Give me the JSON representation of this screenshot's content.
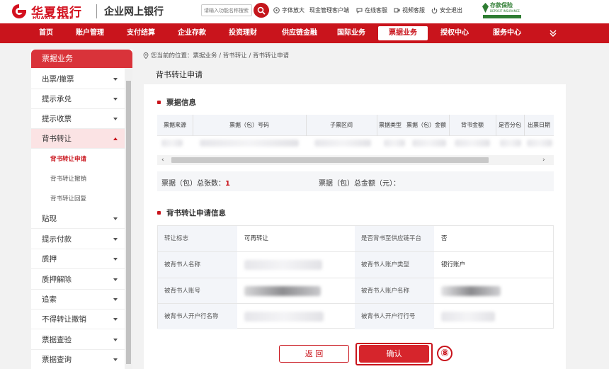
{
  "header": {
    "bank_name_cn": "华夏银行",
    "bank_name_en": "HUAXIA BANK",
    "site_title": "企业网上银行",
    "search_placeholder": "请输入功能名称搜索",
    "links": [
      "字体放大",
      "现金管理客户端",
      "在线客服",
      "视频客服",
      "安全退出"
    ],
    "deposit_logo_text": "存款保险",
    "deposit_logo_en": "DEPOSIT INSURANCE"
  },
  "nav": {
    "items": [
      "首页",
      "账户管理",
      "支付结算",
      "企业存款",
      "投资理财",
      "供应链金融",
      "国际业务",
      "票据业务",
      "授权中心",
      "服务中心"
    ],
    "active": "票据业务"
  },
  "sidebar": {
    "title": "票据业务",
    "items": [
      {
        "label": "出票/撤票"
      },
      {
        "label": "提示承兑"
      },
      {
        "label": "提示收票"
      },
      {
        "label": "背书转让",
        "open": true
      },
      {
        "label": "背书转让申请",
        "sub": true,
        "active": true
      },
      {
        "label": "背书转让撤销",
        "sub": true
      },
      {
        "label": "背书转让回复",
        "sub": true
      },
      {
        "label": "贴现"
      },
      {
        "label": "提示付款"
      },
      {
        "label": "质押"
      },
      {
        "label": "质押解除"
      },
      {
        "label": "追索"
      },
      {
        "label": "不得转让撤销"
      },
      {
        "label": "票据查验"
      },
      {
        "label": "票据查询"
      }
    ]
  },
  "breadcrumb": "您当前的位置：票据业务 / 背书转让 / 背书转让申请",
  "page_title": "背书转让申请",
  "bill_info": {
    "section_title": "票据信息",
    "columns": [
      "票据来源",
      "票据（包）号码",
      "子票区间",
      "票据类型",
      "票据（包）金额",
      "背书金额",
      "是否分包",
      "出票日期"
    ]
  },
  "summary": {
    "count_label": "票据（包）总张数：",
    "count_value": "1",
    "amount_label": "票据（包）总金额（元）："
  },
  "apply_info": {
    "section_title": "背书转让申请信息",
    "rows": [
      {
        "l1": "转让标志",
        "v1": "可再转让",
        "l2": "是否背书至供应链平台",
        "v2": "否"
      },
      {
        "l1": "被背书人名称",
        "v1": "",
        "l2": "被背书人账户类型",
        "v2": "银行账户"
      },
      {
        "l1": "被背书人账号",
        "v1": "",
        "l2": "被背书人账户名称",
        "v2": ""
      },
      {
        "l1": "被背书人开户行名称",
        "v1": "",
        "l2": "被背书人开户行行号",
        "v2": ""
      }
    ]
  },
  "buttons": {
    "back": "返 回",
    "confirm": "确认"
  },
  "step_marker": "⑧"
}
